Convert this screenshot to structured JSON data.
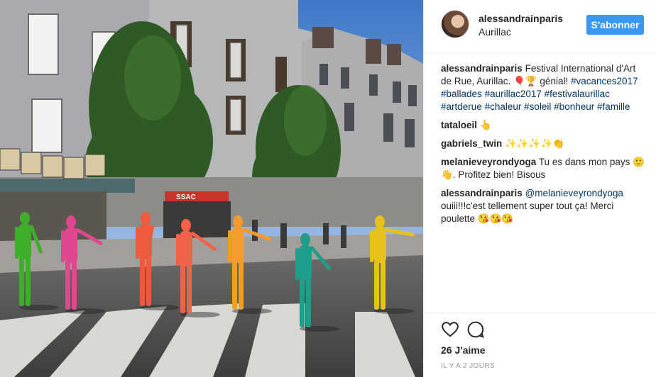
{
  "post": {
    "username": "alessandrainparis",
    "location": "Aurillac",
    "follow_label": "S'abonner",
    "likes": "26 J'aime",
    "time": "IL Y A 2 JOURS"
  },
  "comments": [
    {
      "author": "alessandrainparis",
      "text_parts": [
        {
          "t": "Festival International d'Art de Rue, Aurillac. 🎈🏆 génial! ",
          "tag": false
        },
        {
          "t": "#vacances2017",
          "tag": true
        },
        {
          "t": " ",
          "tag": false
        },
        {
          "t": "#ballades",
          "tag": true
        },
        {
          "t": " ",
          "tag": false
        },
        {
          "t": "#aurillac2017",
          "tag": true
        },
        {
          "t": " ",
          "tag": false
        },
        {
          "t": "#festivalaurillac",
          "tag": true
        },
        {
          "t": " ",
          "tag": false
        },
        {
          "t": "#artderue",
          "tag": true
        },
        {
          "t": " ",
          "tag": false
        },
        {
          "t": "#chaleur",
          "tag": true
        },
        {
          "t": " ",
          "tag": false
        },
        {
          "t": "#soleil",
          "tag": true
        },
        {
          "t": " ",
          "tag": false
        },
        {
          "t": "#bonheur",
          "tag": true
        },
        {
          "t": " ",
          "tag": false
        },
        {
          "t": "#famille",
          "tag": true
        }
      ]
    },
    {
      "author": "tataloeil",
      "text_parts": [
        {
          "t": "👆",
          "tag": false
        }
      ]
    },
    {
      "author": "gabriels_twin",
      "text_parts": [
        {
          "t": "✨✨✨✨👏",
          "tag": false
        }
      ]
    },
    {
      "author": "melanieveyrondyoga",
      "text_parts": [
        {
          "t": "Tu es dans mon pays 🙂👋. Profitez bien! Bisous",
          "tag": false
        }
      ]
    },
    {
      "author": "alessandrainparis",
      "text_parts": [
        {
          "t": "@melanieveyrondyoga",
          "tag": true
        },
        {
          "t": " ouiii!!!c'est tellement super tout ça! Merci poulette 😘😘😘",
          "tag": false
        }
      ]
    }
  ],
  "photo": {
    "shop_sign": "SSAC",
    "figure_colors": [
      "#3fae2a",
      "#e0478f",
      "#ee5a3c",
      "#f2624a",
      "#f59a2c",
      "#1f9e8c",
      "#e8c21a"
    ]
  },
  "icons": {
    "heart": "heart-icon",
    "comment": "comment-icon"
  }
}
